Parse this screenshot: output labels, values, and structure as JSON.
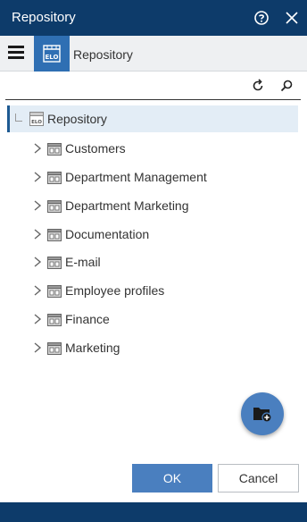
{
  "window": {
    "title": "Repository",
    "icons": {
      "help": "help-circle-icon",
      "close": "close-icon"
    }
  },
  "toolbar": {
    "menu_icon": "hamburger-menu-icon",
    "app_icon": "elo-repository-icon",
    "section_title": "Repository"
  },
  "actions": {
    "refresh_icon": "refresh-icon",
    "search_icon": "search-icon"
  },
  "tree": {
    "root": {
      "label": "Repository",
      "icon": "elo-repository-icon"
    },
    "items": [
      {
        "label": "Customers",
        "icon": "cabinet-icon"
      },
      {
        "label": "Department Management",
        "icon": "cabinet-icon"
      },
      {
        "label": "Department Marketing",
        "icon": "cabinet-icon"
      },
      {
        "label": "Documentation",
        "icon": "cabinet-icon"
      },
      {
        "label": "E-mail",
        "icon": "cabinet-icon"
      },
      {
        "label": "Employee profiles",
        "icon": "cabinet-icon"
      },
      {
        "label": "Finance",
        "icon": "cabinet-icon"
      },
      {
        "label": "Marketing",
        "icon": "cabinet-icon"
      }
    ]
  },
  "fab": {
    "icon": "new-folder-icon"
  },
  "footer": {
    "ok_label": "OK",
    "cancel_label": "Cancel"
  },
  "colors": {
    "titlebar": "#0d3b6a",
    "accent": "#4a7fbf",
    "selection": "#e3edf6"
  }
}
